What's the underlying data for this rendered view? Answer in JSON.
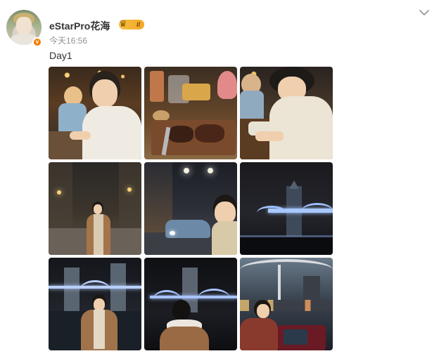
{
  "post": {
    "username": "eStarPro花海",
    "vip_level": "II",
    "timestamp": "今天16:56",
    "text": "Day1",
    "watermark": "",
    "photos": [
      {
        "name": "photo-restaurant-selfie"
      },
      {
        "name": "photo-steak-dinner"
      },
      {
        "name": "photo-restaurant-seated"
      },
      {
        "name": "photo-night-street"
      },
      {
        "name": "photo-street-car-selfie"
      },
      {
        "name": "photo-tower-bridge-night"
      },
      {
        "name": "photo-tower-bridge-portrait"
      },
      {
        "name": "photo-tower-bridge-back-view"
      },
      {
        "name": "photo-riverside-photo-taking"
      }
    ]
  },
  "icons": {
    "verified": "v-badge-icon",
    "vip": "crown-icon",
    "more": "chevron-down-icon"
  },
  "colors": {
    "verified_badge": "#f57c00",
    "vip_badge": "#f5a623",
    "timestamp": "#939393"
  }
}
